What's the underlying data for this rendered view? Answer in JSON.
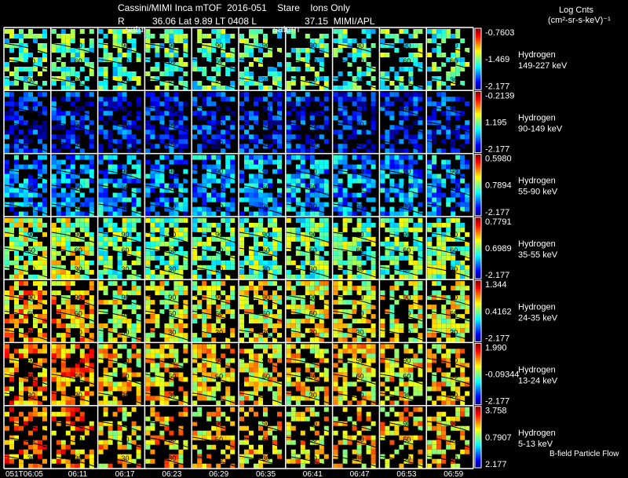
{
  "chart_data": {
    "type": "heatmap",
    "title": "Cassini/MIMI Inca mTOF  2016-051    Stare    Ions Only",
    "subtitle": {
      "r_label": "R",
      "orbit": "36.06 Lat 9.89 LT 0408 L",
      "l_value": "37.15  MIMI/APL"
    },
    "overlay_labels": [
      "satur",
      "saturn"
    ],
    "colorbar_title": "Log Cnts",
    "colorbar_units": "(cm²-sr-s-keV)⁻¹",
    "x_tick_labels": [
      "051T06:05",
      "06:11",
      "06:17",
      "06:23",
      "06:29",
      "06:35",
      "06:41",
      "06:47",
      "06:53",
      "06:59"
    ],
    "contour_labels": [
      "90",
      "60",
      "30"
    ],
    "footer_label": "B-field Particle Flow",
    "rows": [
      {
        "species": "Hydrogen",
        "energy": "149-227 keV",
        "cb_max": "-0.7603",
        "cb_mid": "-1.469",
        "cb_min": "-2.177",
        "mean_level": 0.45,
        "fill": 0.55
      },
      {
        "species": "Hydrogen",
        "energy": "90-149 keV",
        "cb_max": "-0.2139",
        "cb_mid": "1.195",
        "cb_min": "-2.177",
        "mean_level": 0.14,
        "fill": 0.6
      },
      {
        "species": "Hydrogen",
        "energy": "55-90 keV",
        "cb_max": "0.5980",
        "cb_mid": "0.7894",
        "cb_min": "-2.177",
        "mean_level": 0.28,
        "fill": 0.7
      },
      {
        "species": "Hydrogen",
        "energy": "35-55 keV",
        "cb_max": "0.7791",
        "cb_mid": "0.6989",
        "cb_min": "-2.177",
        "mean_level": 0.48,
        "fill": 0.72
      },
      {
        "species": "Hydrogen",
        "energy": "24-35 keV",
        "cb_max": "1.344",
        "cb_mid": "0.4162",
        "cb_min": "-2.177",
        "mean_level": 0.6,
        "fill": 0.65
      },
      {
        "species": "Hydrogen",
        "energy": "13-24 keV",
        "cb_max": "1.990",
        "cb_mid": "-0.09344",
        "cb_min": "-2.177",
        "mean_level": 0.64,
        "fill": 0.62
      },
      {
        "species": "Hydrogen",
        "energy": "5-13 keV",
        "cb_max": "3.758",
        "cb_mid": "0.7907",
        "cb_min": "2.177",
        "mean_level": 0.66,
        "fill": 0.45
      }
    ]
  }
}
